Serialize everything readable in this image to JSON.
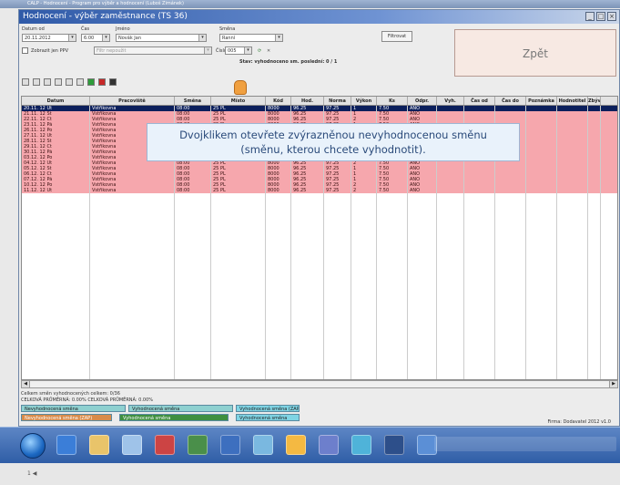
{
  "outer_title": "CALP - Hodnocení - Program pro výběr a hodnocení (Luboš Zimánek)",
  "window": {
    "title": "Hodnocení - výběr zaměstnance (TS 36)",
    "buttons": [
      "_",
      "□",
      "×"
    ]
  },
  "filters": {
    "date_from_label": "Datum od",
    "date_from_value": "20.11.2012",
    "time_label": "Čas",
    "time_value": "6:00",
    "name_label": "Jméno",
    "name_value": "Novák Jan",
    "shift_label": "Směna",
    "shift_value": "Ranní",
    "shifts_only_label": "Zobrazit jen PPV",
    "disabled_field": "Filtr nepoužit",
    "number_label": "Číslo",
    "number_value": "005",
    "status_text": "Stav: vyhodnoceno sm. poslední: 0 / 1",
    "filter_button": "Filtrovat",
    "back_button": "Zpět"
  },
  "grid": {
    "columns": [
      "Datum",
      "Pracoviště",
      "Směna",
      "Místo",
      "Kód",
      "Hod.",
      "Norma",
      "Výkon",
      "Ks",
      "Odpr.",
      "Vyh.",
      "Čas od",
      "Čas do",
      "Poznámka",
      "Hodnotitel",
      "Zbývá"
    ],
    "rows": [
      [
        "20.11. 12 Út",
        "Vstřikovna",
        "08:00",
        "25 PL",
        "8000",
        "96.25",
        "97.25",
        "1",
        "7.50",
        "ANO",
        "",
        "",
        "",
        "",
        "",
        ""
      ],
      [
        "21.11. 12 St",
        "Vstřikovna",
        "08:00",
        "25 PL",
        "8000",
        "96.25",
        "97.25",
        "1",
        "7.50",
        "ANO",
        "",
        "",
        "",
        "",
        "",
        ""
      ],
      [
        "22.11. 12 Čt",
        "Vstřikovna",
        "08:00",
        "25 PL",
        "8000",
        "96.25",
        "97.25",
        "2",
        "7.50",
        "ANO",
        "",
        "",
        "",
        "",
        "",
        ""
      ],
      [
        "23.11. 12 Pá",
        "Vstřikovna",
        "08:00",
        "25 PL",
        "8000",
        "96.25",
        "97.25",
        "1",
        "7.50",
        "ANO",
        "",
        "",
        "",
        "",
        "",
        ""
      ],
      [
        "26.11. 12 Po",
        "Vstřikovna",
        "08:00",
        "25 PL",
        "8000",
        "96.25",
        "97.25",
        "1",
        "7.50",
        "ANO",
        "",
        "",
        "",
        "",
        "",
        ""
      ],
      [
        "27.11. 12 Út",
        "Vstřikovna",
        "08:00",
        "25 PL",
        "8000",
        "96.25",
        "97.25",
        "2",
        "7.50",
        "ANO",
        "",
        "",
        "",
        "",
        "",
        ""
      ],
      [
        "28.11. 12 St",
        "Vstřikovna",
        "08:00",
        "25 PL",
        "8000",
        "96.25",
        "97.25",
        "2",
        "7.50",
        "ANO",
        "",
        "",
        "",
        "",
        "",
        ""
      ],
      [
        "29.11. 12 Čt",
        "Vstřikovna",
        "08:00",
        "25 PL",
        "8000",
        "96.25",
        "97.25",
        "1",
        "7.50",
        "ANO",
        "",
        "",
        "",
        "",
        "",
        ""
      ],
      [
        "30.11. 12 Pá",
        "Vstřikovna",
        "08:00",
        "25 PL",
        "8000",
        "96.25",
        "97.25",
        "1",
        "7.50",
        "ANO",
        "",
        "",
        "",
        "",
        "",
        ""
      ],
      [
        "03.12. 12 Po",
        "Vstřikovna",
        "08:00",
        "25 PL",
        "8000",
        "96.25",
        "97.25",
        "2",
        "7.50",
        "ANO",
        "",
        "",
        "",
        "",
        "",
        ""
      ],
      [
        "04.12. 12 Út",
        "Vstřikovna",
        "08:00",
        "25 PL",
        "8000",
        "96.25",
        "97.25",
        "2",
        "7.50",
        "ANO",
        "",
        "",
        "",
        "",
        "",
        ""
      ],
      [
        "05.12. 12 St",
        "Vstřikovna",
        "08:00",
        "25 PL",
        "8000",
        "96.25",
        "97.25",
        "1",
        "7.50",
        "ANO",
        "",
        "",
        "",
        "",
        "",
        ""
      ],
      [
        "06.12. 12 Čt",
        "Vstřikovna",
        "08:00",
        "25 PL",
        "8000",
        "96.25",
        "97.25",
        "1",
        "7.50",
        "ANO",
        "",
        "",
        "",
        "",
        "",
        ""
      ],
      [
        "07.12. 12 Pá",
        "Vstřikovna",
        "08:00",
        "25 PL",
        "8000",
        "96.25",
        "97.25",
        "1",
        "7.50",
        "ANO",
        "",
        "",
        "",
        "",
        "",
        ""
      ],
      [
        "10.12. 12 Po",
        "Vstřikovna",
        "08:00",
        "25 PL",
        "8000",
        "96.25",
        "97.25",
        "2",
        "7.50",
        "ANO",
        "",
        "",
        "",
        "",
        "",
        ""
      ],
      [
        "11.12. 12 Út",
        "Vstřikovna",
        "08:00",
        "25 PL",
        "8000",
        "96.25",
        "97.25",
        "2",
        "7.50",
        "ANO",
        "",
        "",
        "",
        "",
        "",
        ""
      ]
    ]
  },
  "tooltip": {
    "line1": "Dvojklikem otevřete zvýrazněnou nevyhodnocenou směnu",
    "line2": "(směnu, kterou chcete vyhodnotit)."
  },
  "status": {
    "line1": "Celkem směn vyhodnocených celkem: 0/36",
    "line2": "CELKOVÁ PRŮMĚRNÁ: 0.00%    CELKOVÁ PRŮMĚRNÁ: 0.00%"
  },
  "legend": {
    "item1": "Nevyhodnocená směna",
    "item2": "Vyhodnocená směna",
    "item3": "Nevyhodnocená směna (ZAP)",
    "item4": "Vyhodnocená směna",
    "item5": "Vyhodnocená směna (ZAP)",
    "item6": "Vyhodnocená směna"
  },
  "footer_right": "Firma: Dodavatel 2012 v1.0",
  "bottom_text": "1 ◀",
  "colors": {
    "row_unrated": "#f6a7ad",
    "row_selected": "#0b1f5c",
    "legend_teal": "#8ed0d0",
    "legend_green": "#3f8f3f",
    "legend_cyan": "#7fd4e4"
  }
}
